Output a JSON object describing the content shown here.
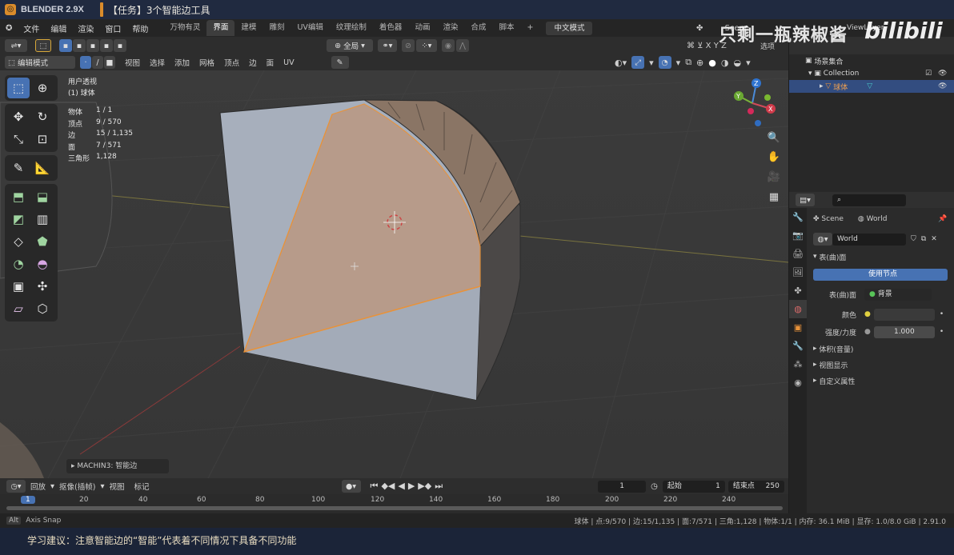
{
  "titlebar": {
    "app": "BLENDER 2.9X",
    "task": "【任务】3个智能边工具"
  },
  "menu": [
    "文件",
    "编辑",
    "渲染",
    "窗口",
    "帮助"
  ],
  "workspaces": [
    "万物有灵",
    "界面",
    "建模",
    "雕刻",
    "UV编辑",
    "纹理绘制",
    "着色器",
    "动画",
    "渲染",
    "合成",
    "脚本"
  ],
  "active_workspace": "界面",
  "mode_button": "中文模式",
  "scene_label": "Scene",
  "viewlayer_label": "ViewLayer",
  "options_label": "选项",
  "transform": {
    "orientation": "全局"
  },
  "edit_header": {
    "mode": "编辑模式",
    "menus": [
      "视图",
      "选择",
      "添加",
      "网格",
      "顶点",
      "边",
      "面",
      "UV"
    ]
  },
  "viewport": {
    "view_name": "用户透视",
    "object_name": "(1) 球体",
    "stats": [
      {
        "k": "物体",
        "v": "1 / 1"
      },
      {
        "k": "顶点",
        "v": "9 / 570"
      },
      {
        "k": "边",
        "v": "15 / 1,135"
      },
      {
        "k": "面",
        "v": "7 / 571"
      },
      {
        "k": "三角形",
        "v": "1,128"
      }
    ],
    "operator_panel": "MACHIN3: 智能边",
    "gizmo": {
      "x": "X",
      "y": "Y",
      "z": "Z"
    }
  },
  "outliner": {
    "root": "场景集合",
    "collection": "Collection",
    "object": "球体"
  },
  "properties": {
    "scene_tab": "Scene",
    "world_tab": "World",
    "world_name": "World",
    "section_surface": "表(曲)面",
    "use_nodes": "使用节点",
    "surface_label": "表(曲)面",
    "surface_value": "背景",
    "color_label": "颜色",
    "strength_label": "强度/力度",
    "strength_value": "1.000",
    "sections": [
      "体积(音量)",
      "视图显示",
      "自定义属性"
    ]
  },
  "timeline": {
    "menus": [
      "回放",
      "抠像(插帧)",
      "视图",
      "标记"
    ],
    "current_frame": "1",
    "start_label": "起始",
    "start": "1",
    "end_label": "结束点",
    "end": "250",
    "ruler": [
      "1",
      "20",
      "40",
      "60",
      "80",
      "100",
      "120",
      "140",
      "160",
      "180",
      "200",
      "220",
      "240"
    ]
  },
  "status": {
    "left": "Axis Snap",
    "right": "球体 | 点:9/570 | 边:15/1,135 | 面:7/571 | 三角:1,128 | 物体:1/1 | 内存: 36.1 MiB | 显存: 1.0/8.0 GiB | 2.91.0"
  },
  "subtitle": "学习建议：注意智能边的“智能”代表着不同情况下具备不同功能",
  "watermark": "只剩一瓶辣椒酱",
  "brand": "bilibili",
  "colors": {
    "accent": "#4772b3",
    "selection": "#e8923a",
    "header": "#2d2d2d"
  }
}
